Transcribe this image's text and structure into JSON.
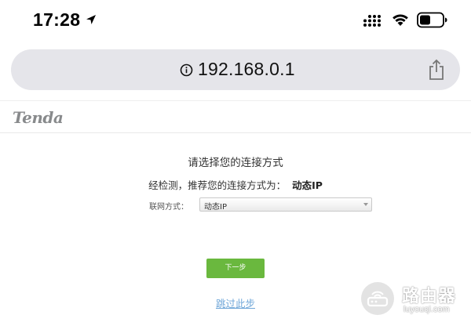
{
  "status_bar": {
    "time": "17:28",
    "icons": [
      "location-arrow-icon",
      "signal-icon",
      "wifi-icon",
      "battery-icon"
    ]
  },
  "browser": {
    "url": "192.168.0.1",
    "icons": [
      "info-icon",
      "share-icon"
    ]
  },
  "brand": {
    "logo_text": "Tenda"
  },
  "main": {
    "title": "请选择您的连接方式",
    "detect_label": "经检测，推荐您的连接方式为：",
    "detect_result": "动态IP",
    "connection_label": "联网方式：",
    "connection_selected": "动态IP",
    "next_label": "下一步",
    "skip_label": "跳过此步"
  },
  "watermark": {
    "text": "路由器",
    "subtext": "luyouqi.com"
  },
  "colors": {
    "accent_green": "#6ab83e",
    "link_blue": "#6fa6d8",
    "url_bar_bg": "#e5e5ea",
    "logo_gray": "#888a8c"
  }
}
